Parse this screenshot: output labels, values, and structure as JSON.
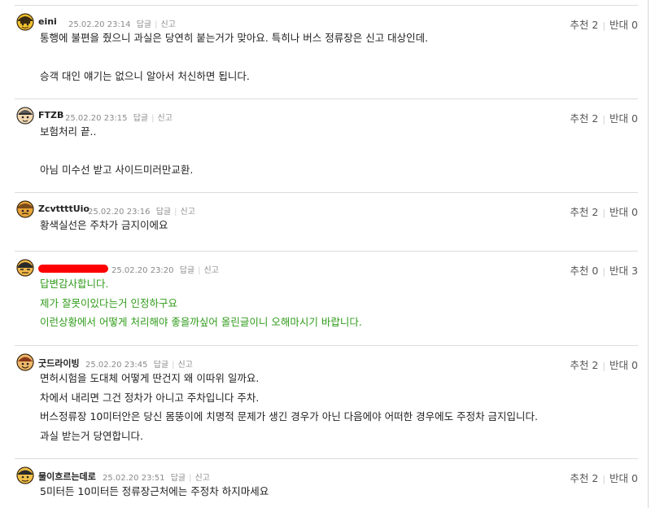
{
  "comments": [
    {
      "nick": "eini",
      "date": "25.02.20 23:14",
      "reply": "답글",
      "report": "신고",
      "recommend": "추천",
      "recommend_count": "2",
      "oppose": "반대",
      "oppose_count": "0",
      "lines": [
        "통행에 불편을 줬으니 과실은 당연히 붙는거가 맞아요. 특히나 버스 정류장은 신고 대상인데.",
        "",
        "승객 대인 얘기는 없으니 알아서 처신하면 됩니다."
      ]
    },
    {
      "nick": "FTZB",
      "date": "25.02.20 23:15",
      "reply": "답글",
      "report": "신고",
      "recommend": "추천",
      "recommend_count": "2",
      "oppose": "반대",
      "oppose_count": "0",
      "lines": [
        "보험처리 끝..",
        "",
        "아님 미수선 받고 사이드미러만교환."
      ]
    },
    {
      "nick": "ZcvttttUio",
      "date": "25.02.20 23:16",
      "reply": "답글",
      "report": "신고",
      "recommend": "추천",
      "recommend_count": "2",
      "oppose": "반대",
      "oppose_count": "0",
      "lines": [
        "황색실선은 주차가 금지이에요"
      ]
    },
    {
      "nick": "",
      "date": "25.02.20 23:20",
      "reply": "답글",
      "report": "신고",
      "recommend": "추천",
      "recommend_count": "0",
      "oppose": "반대",
      "oppose_count": "3",
      "lines": [
        "답변감사합니다.",
        "제가 잘못이있다는거 인정하구요",
        "이런상황에서 어떻게 처리해야 좋을까싶어 올린글이니 오해마시기 바랍니다."
      ]
    },
    {
      "nick": "굿드라이빙",
      "date": "25.02.20 23:45",
      "reply": "답글",
      "report": "신고",
      "recommend": "추천",
      "recommend_count": "2",
      "oppose": "반대",
      "oppose_count": "0",
      "lines": [
        "면허시험을 도대체 어떻게 딴건지 왜 이따위 일까요.",
        "차에서 내리면 그건 정차가 아니고 주차입니다 주차.",
        "버스정류장 10미터안은 당신 몸뚱이에 치명적 문제가 생긴 경우가 아닌 다음에야 어떠한 경우에도 주정차 금지입니다.",
        "과실 받는거 당연합니다."
      ]
    },
    {
      "nick": "물이흐르는데로",
      "date": "25.02.20 23:51",
      "reply": "답글",
      "report": "신고",
      "recommend": "추천",
      "recommend_count": "2",
      "oppose": "반대",
      "oppose_count": "0",
      "lines": [
        "5미터든 10미터든 정류장근처에는 주정차 하지마세요"
      ]
    }
  ]
}
